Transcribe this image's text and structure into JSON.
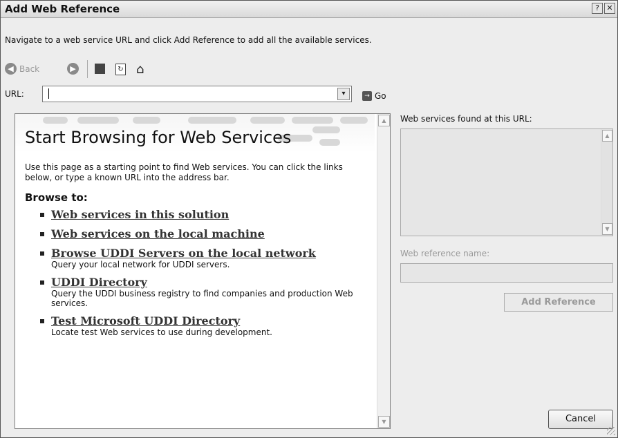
{
  "window": {
    "title": "Add Web Reference",
    "help_glyph": "?",
    "close_glyph": "✕"
  },
  "instructions": "Navigate to a web service URL and click Add Reference to add all the available services.",
  "toolbar": {
    "back_label": "Back",
    "back_icon": "left-arrow-icon",
    "forward_icon": "right-arrow-icon",
    "stop_icon": "stop-icon",
    "refresh_icon": "refresh-icon",
    "home_icon": "home-icon"
  },
  "url": {
    "label": "URL:",
    "value": "",
    "dropdown_glyph": "▾"
  },
  "go": {
    "label": "Go",
    "glyph": "→"
  },
  "browser": {
    "heading": "Start Browsing for Web Services",
    "intro": "Use this page as a starting point to find Web services. You can click the links below, or type a known URL into the address bar.",
    "browse_to": "Browse to:",
    "links": [
      {
        "title": "Web services in this solution",
        "desc": ""
      },
      {
        "title": "Web services on the local machine",
        "desc": ""
      },
      {
        "title": "Browse UDDI Servers on the local network",
        "desc": "Query your local network for UDDI servers."
      },
      {
        "title": "UDDI Directory",
        "desc": "Query the UDDI business registry to find companies and production Web services."
      },
      {
        "title": "Test Microsoft UDDI Directory",
        "desc": "Locate test Web services to use during development."
      }
    ],
    "scroll_up": "▲",
    "scroll_down": "▼"
  },
  "right_panel": {
    "found_label": "Web services found at this URL:",
    "name_label": "Web reference name:",
    "name_value": "",
    "add_reference_label": "Add Reference"
  },
  "footer": {
    "cancel_label": "Cancel"
  }
}
